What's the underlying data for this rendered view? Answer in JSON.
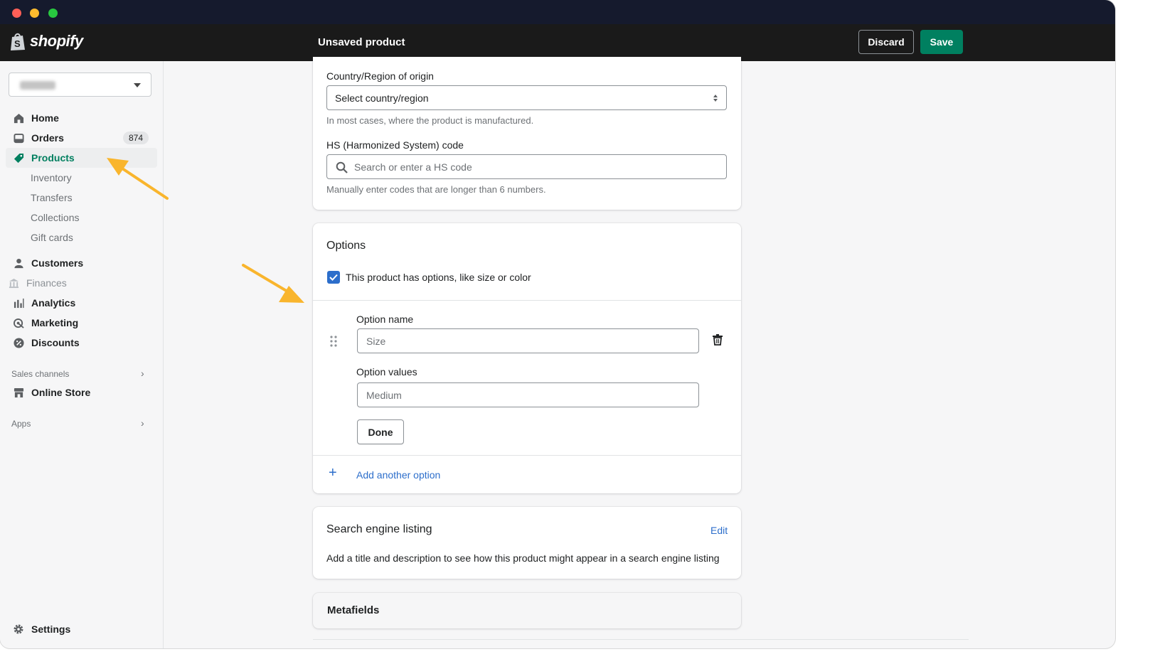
{
  "window": {
    "brand": "shopify",
    "page_title": "Unsaved product",
    "discard_label": "Discard",
    "save_label": "Save"
  },
  "sidebar": {
    "nav": [
      {
        "label": "Home",
        "icon": "home-icon"
      },
      {
        "label": "Orders",
        "icon": "orders-icon",
        "badge": "874"
      },
      {
        "label": "Products",
        "icon": "tag-icon",
        "active": true
      },
      {
        "label": "Customers",
        "icon": "person-icon"
      },
      {
        "label": "Finances",
        "icon": "bank-icon"
      },
      {
        "label": "Analytics",
        "icon": "bar-chart-icon"
      },
      {
        "label": "Marketing",
        "icon": "target-icon"
      },
      {
        "label": "Discounts",
        "icon": "discount-icon"
      }
    ],
    "product_sub": [
      "Inventory",
      "Transfers",
      "Collections",
      "Gift cards"
    ],
    "sales_channels_label": "Sales channels",
    "online_store_label": "Online Store",
    "apps_label": "Apps",
    "settings_label": "Settings"
  },
  "customs": {
    "country_label": "Country/Region of origin",
    "country_value": "Select country/region",
    "country_help": "In most cases, where the product is manufactured.",
    "hs_label": "HS (Harmonized System) code",
    "hs_placeholder": "Search or enter a HS code",
    "hs_help": "Manually enter codes that are longer than 6 numbers."
  },
  "options": {
    "title": "Options",
    "checkbox_label": "This product has options, like size or color",
    "checked": true,
    "option_name_label": "Option name",
    "option_name_placeholder": "Size",
    "option_values_label": "Option values",
    "option_values_placeholder": "Medium",
    "done_label": "Done",
    "add_another_label": "Add another option"
  },
  "seo": {
    "title": "Search engine listing",
    "edit_label": "Edit",
    "description": "Add a title and description to see how this product might appear in a search engine listing"
  },
  "metafields": {
    "title": "Metafields"
  },
  "colors": {
    "accent": "#008060",
    "link": "#2c6ecb",
    "arrow": "#f9b52d",
    "topbar": "#1a1a1a"
  }
}
